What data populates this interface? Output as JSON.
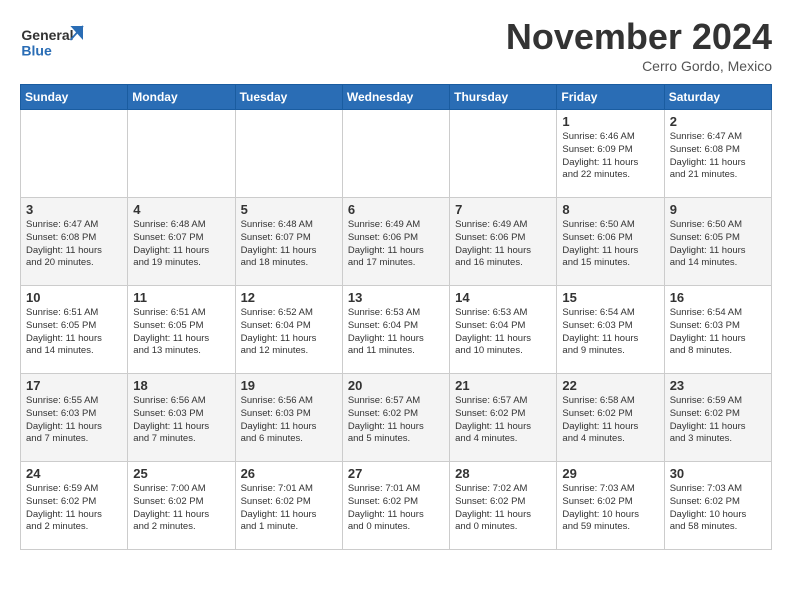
{
  "header": {
    "logo_line1": "General",
    "logo_line2": "Blue",
    "month_title": "November 2024",
    "location": "Cerro Gordo, Mexico"
  },
  "days_of_week": [
    "Sunday",
    "Monday",
    "Tuesday",
    "Wednesday",
    "Thursday",
    "Friday",
    "Saturday"
  ],
  "weeks": [
    [
      {
        "day": "",
        "info": ""
      },
      {
        "day": "",
        "info": ""
      },
      {
        "day": "",
        "info": ""
      },
      {
        "day": "",
        "info": ""
      },
      {
        "day": "",
        "info": ""
      },
      {
        "day": "1",
        "info": "Sunrise: 6:46 AM\nSunset: 6:09 PM\nDaylight: 11 hours\nand 22 minutes."
      },
      {
        "day": "2",
        "info": "Sunrise: 6:47 AM\nSunset: 6:08 PM\nDaylight: 11 hours\nand 21 minutes."
      }
    ],
    [
      {
        "day": "3",
        "info": "Sunrise: 6:47 AM\nSunset: 6:08 PM\nDaylight: 11 hours\nand 20 minutes."
      },
      {
        "day": "4",
        "info": "Sunrise: 6:48 AM\nSunset: 6:07 PM\nDaylight: 11 hours\nand 19 minutes."
      },
      {
        "day": "5",
        "info": "Sunrise: 6:48 AM\nSunset: 6:07 PM\nDaylight: 11 hours\nand 18 minutes."
      },
      {
        "day": "6",
        "info": "Sunrise: 6:49 AM\nSunset: 6:06 PM\nDaylight: 11 hours\nand 17 minutes."
      },
      {
        "day": "7",
        "info": "Sunrise: 6:49 AM\nSunset: 6:06 PM\nDaylight: 11 hours\nand 16 minutes."
      },
      {
        "day": "8",
        "info": "Sunrise: 6:50 AM\nSunset: 6:06 PM\nDaylight: 11 hours\nand 15 minutes."
      },
      {
        "day": "9",
        "info": "Sunrise: 6:50 AM\nSunset: 6:05 PM\nDaylight: 11 hours\nand 14 minutes."
      }
    ],
    [
      {
        "day": "10",
        "info": "Sunrise: 6:51 AM\nSunset: 6:05 PM\nDaylight: 11 hours\nand 14 minutes."
      },
      {
        "day": "11",
        "info": "Sunrise: 6:51 AM\nSunset: 6:05 PM\nDaylight: 11 hours\nand 13 minutes."
      },
      {
        "day": "12",
        "info": "Sunrise: 6:52 AM\nSunset: 6:04 PM\nDaylight: 11 hours\nand 12 minutes."
      },
      {
        "day": "13",
        "info": "Sunrise: 6:53 AM\nSunset: 6:04 PM\nDaylight: 11 hours\nand 11 minutes."
      },
      {
        "day": "14",
        "info": "Sunrise: 6:53 AM\nSunset: 6:04 PM\nDaylight: 11 hours\nand 10 minutes."
      },
      {
        "day": "15",
        "info": "Sunrise: 6:54 AM\nSunset: 6:03 PM\nDaylight: 11 hours\nand 9 minutes."
      },
      {
        "day": "16",
        "info": "Sunrise: 6:54 AM\nSunset: 6:03 PM\nDaylight: 11 hours\nand 8 minutes."
      }
    ],
    [
      {
        "day": "17",
        "info": "Sunrise: 6:55 AM\nSunset: 6:03 PM\nDaylight: 11 hours\nand 7 minutes."
      },
      {
        "day": "18",
        "info": "Sunrise: 6:56 AM\nSunset: 6:03 PM\nDaylight: 11 hours\nand 7 minutes."
      },
      {
        "day": "19",
        "info": "Sunrise: 6:56 AM\nSunset: 6:03 PM\nDaylight: 11 hours\nand 6 minutes."
      },
      {
        "day": "20",
        "info": "Sunrise: 6:57 AM\nSunset: 6:02 PM\nDaylight: 11 hours\nand 5 minutes."
      },
      {
        "day": "21",
        "info": "Sunrise: 6:57 AM\nSunset: 6:02 PM\nDaylight: 11 hours\nand 4 minutes."
      },
      {
        "day": "22",
        "info": "Sunrise: 6:58 AM\nSunset: 6:02 PM\nDaylight: 11 hours\nand 4 minutes."
      },
      {
        "day": "23",
        "info": "Sunrise: 6:59 AM\nSunset: 6:02 PM\nDaylight: 11 hours\nand 3 minutes."
      }
    ],
    [
      {
        "day": "24",
        "info": "Sunrise: 6:59 AM\nSunset: 6:02 PM\nDaylight: 11 hours\nand 2 minutes."
      },
      {
        "day": "25",
        "info": "Sunrise: 7:00 AM\nSunset: 6:02 PM\nDaylight: 11 hours\nand 2 minutes."
      },
      {
        "day": "26",
        "info": "Sunrise: 7:01 AM\nSunset: 6:02 PM\nDaylight: 11 hours\nand 1 minute."
      },
      {
        "day": "27",
        "info": "Sunrise: 7:01 AM\nSunset: 6:02 PM\nDaylight: 11 hours\nand 0 minutes."
      },
      {
        "day": "28",
        "info": "Sunrise: 7:02 AM\nSunset: 6:02 PM\nDaylight: 11 hours\nand 0 minutes."
      },
      {
        "day": "29",
        "info": "Sunrise: 7:03 AM\nSunset: 6:02 PM\nDaylight: 10 hours\nand 59 minutes."
      },
      {
        "day": "30",
        "info": "Sunrise: 7:03 AM\nSunset: 6:02 PM\nDaylight: 10 hours\nand 58 minutes."
      }
    ]
  ]
}
